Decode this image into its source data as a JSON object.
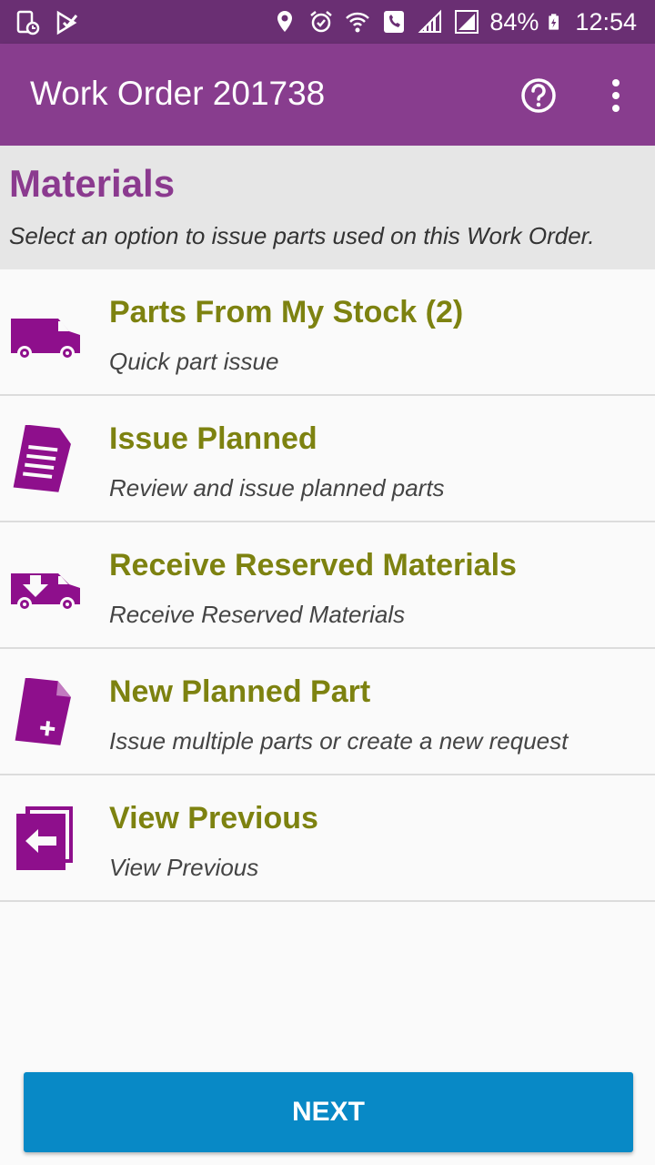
{
  "status_bar": {
    "battery": "84%",
    "time": "12:54"
  },
  "app_bar": {
    "title": "Work Order 201738"
  },
  "section": {
    "title": "Materials",
    "subtitle": "Select an option to issue parts used on this Work Order."
  },
  "options": [
    {
      "title": "Parts From My Stock (2)",
      "subtitle": "Quick part issue",
      "icon": "van-icon"
    },
    {
      "title": "Issue Planned",
      "subtitle": "Review and issue planned parts",
      "icon": "document-icon"
    },
    {
      "title": "Receive Reserved Materials",
      "subtitle": "Receive Reserved Materials",
      "icon": "van-download-icon"
    },
    {
      "title": "New Planned Part",
      "subtitle": "Issue multiple parts or create a new request",
      "icon": "document-add-icon"
    },
    {
      "title": "View Previous",
      "subtitle": "View Previous",
      "icon": "previous-pages-icon"
    }
  ],
  "footer": {
    "next_label": "NEXT"
  },
  "colors": {
    "status_bar": "#6a2f73",
    "app_bar": "#883d8e",
    "accent_purple": "#8b3a8f",
    "icon_purple": "#8e0f8c",
    "title_olive": "#7d8210",
    "button_blue": "#0889c6"
  }
}
